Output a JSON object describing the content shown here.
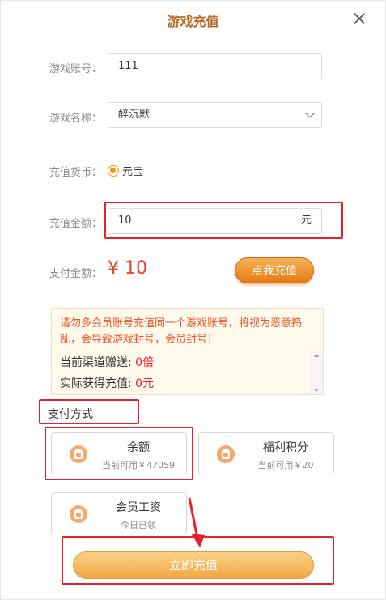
{
  "header": {
    "title": "游戏充值"
  },
  "form": {
    "account_label": "游戏账号：",
    "account_value": "111",
    "game_label": "游戏名称：",
    "game_value": "醉沉默",
    "currency_label": "充值货币：",
    "currency_option": "元宝",
    "amount_label": "充值金额：",
    "amount_value": "10",
    "amount_unit": "元",
    "pay_label": "支付金额：",
    "pay_amount": "¥ 10",
    "recharge_button": "点我充值"
  },
  "notice": {
    "warning": "请勿多会员账号充值同一个游戏账号，将视为恶意捣乱，会导致游戏封号，会员封号！",
    "bonus_label": "当前渠道赠送: ",
    "bonus_value": "0倍",
    "actual_label": "实际获得充值: ",
    "actual_value": "0元"
  },
  "payment": {
    "title": "支付方式",
    "methods": [
      {
        "name": "余额",
        "sub": "当前可用￥47059"
      },
      {
        "name": "福利积分",
        "sub": "当前可用￥20"
      },
      {
        "name": "会员工资",
        "sub": "今日已领"
      }
    ]
  },
  "submit_button": "立即充值",
  "colors": {
    "accent": "#f39c12",
    "highlight_box": "#e8202a",
    "warning_text": "#e8562a"
  }
}
